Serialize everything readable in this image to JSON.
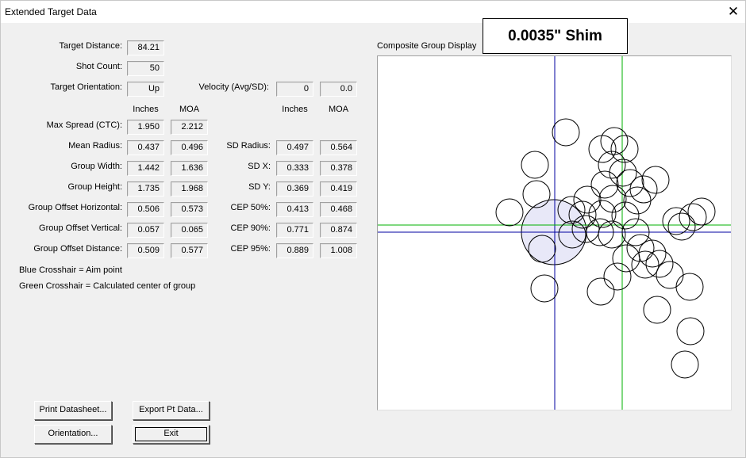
{
  "window": {
    "title": "Extended Target Data",
    "close_glyph": "✕"
  },
  "fields": {
    "target_distance": {
      "label": "Target Distance:",
      "value": "84.21"
    },
    "shot_count": {
      "label": "Shot Count:",
      "value": "50"
    },
    "target_orientation": {
      "label": "Target Orientation:",
      "value": "Up"
    },
    "velocity": {
      "label": "Velocity (Avg/SD):",
      "avg": "0",
      "sd": "0.0"
    }
  },
  "headers": {
    "left_inches": "Inches",
    "left_moa": "MOA",
    "right_inches": "Inches",
    "right_moa": "MOA"
  },
  "left_rows": [
    {
      "label": "Max Spread (CTC):",
      "inches": "1.950",
      "moa": "2.212"
    },
    {
      "label": "Mean Radius:",
      "inches": "0.437",
      "moa": "0.496"
    },
    {
      "label": "Group Width:",
      "inches": "1.442",
      "moa": "1.636"
    },
    {
      "label": "Group Height:",
      "inches": "1.735",
      "moa": "1.968"
    },
    {
      "label": "Group Offset Horizontal:",
      "inches": "0.506",
      "moa": "0.573"
    },
    {
      "label": "Group Offset Vertical:",
      "inches": "0.057",
      "moa": "0.065"
    },
    {
      "label": "Group Offset Distance:",
      "inches": "0.509",
      "moa": "0.577"
    }
  ],
  "right_rows": [
    {
      "label": "SD Radius:",
      "inches": "0.497",
      "moa": "0.564"
    },
    {
      "label": "SD X:",
      "inches": "0.333",
      "moa": "0.378"
    },
    {
      "label": "SD Y:",
      "inches": "0.369",
      "moa": "0.419"
    },
    {
      "label": "CEP 50%:",
      "inches": "0.413",
      "moa": "0.468"
    },
    {
      "label": "CEP 90%:",
      "inches": "0.771",
      "moa": "0.874"
    },
    {
      "label": "CEP 95%:",
      "inches": "0.889",
      "moa": "1.008"
    }
  ],
  "legend": {
    "blue": "Blue Crosshair = Aim point",
    "green": "Green Crosshair = Calculated center of group"
  },
  "buttons": {
    "print": "Print Datasheet...",
    "export": "Export Pt Data...",
    "orientation": "Orientation...",
    "exit": "Exit"
  },
  "display": {
    "label": "Composite Group Display",
    "overlay": "0.0035\" Shim",
    "aim_color": "#0000a0",
    "center_color": "#00b000",
    "cep_fill": "#e8e8f8"
  }
}
